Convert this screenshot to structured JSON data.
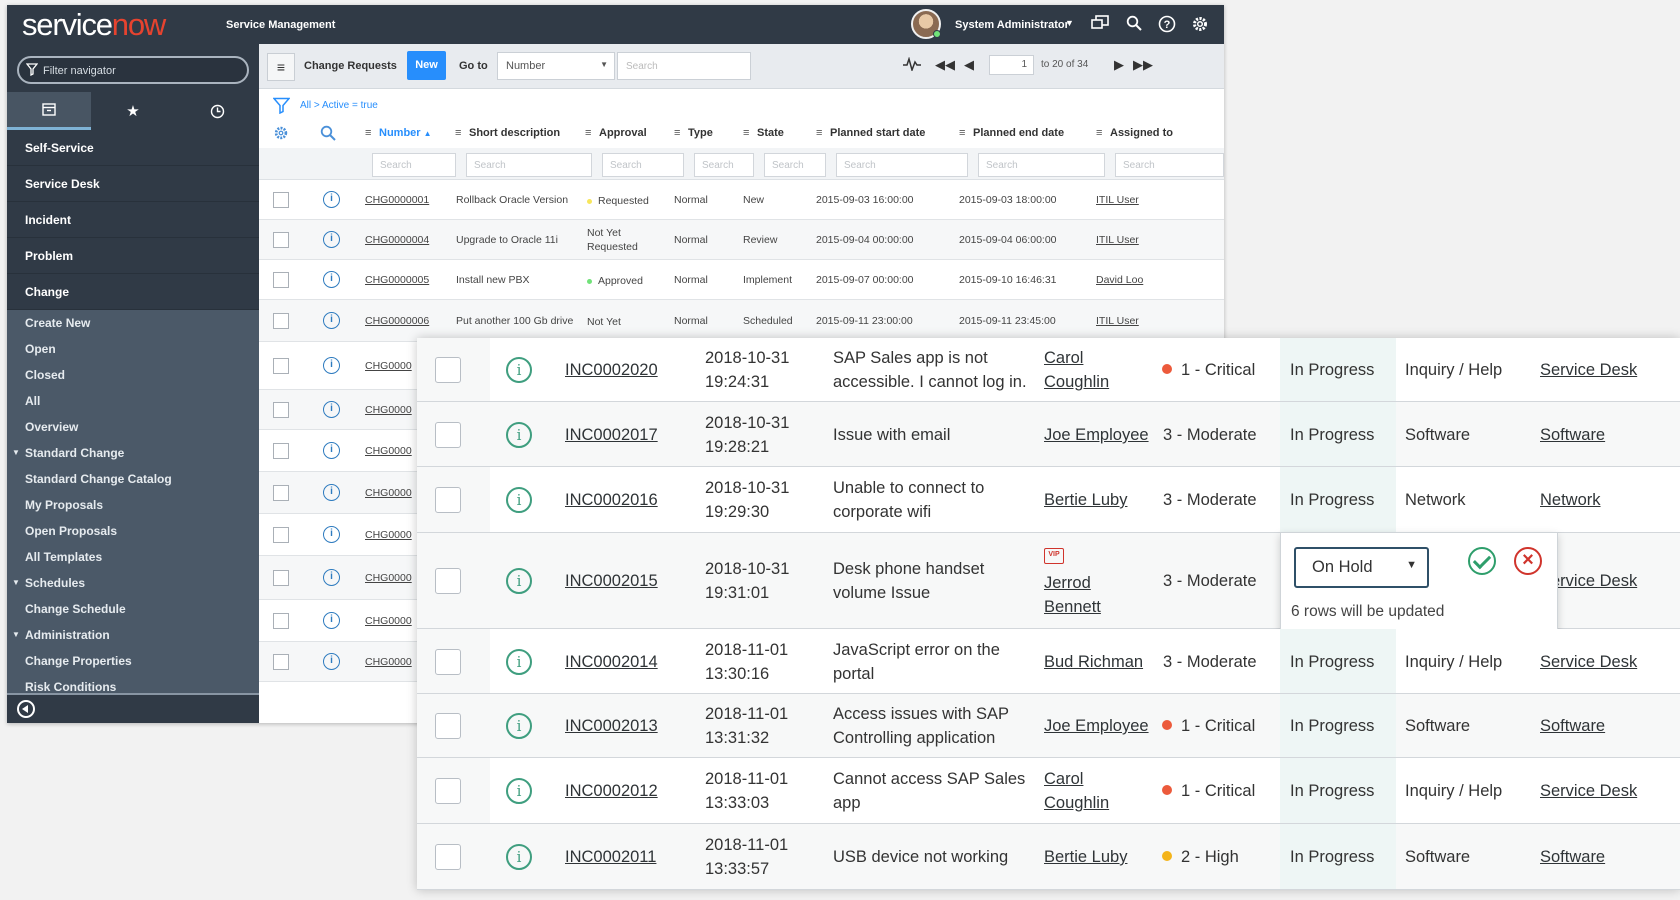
{
  "app": {
    "logo_service": "service",
    "logo_now": "now",
    "product": "Service Management",
    "user_name": "System Administrator"
  },
  "nav": {
    "filter_placeholder": "Filter navigator",
    "modules": [
      "Self-Service",
      "Service Desk",
      "Incident",
      "Problem",
      "Change"
    ],
    "change_items": [
      {
        "label": "Create New",
        "group": false
      },
      {
        "label": "Open",
        "group": false
      },
      {
        "label": "Closed",
        "group": false
      },
      {
        "label": "All",
        "group": false
      },
      {
        "label": "Overview",
        "group": false
      },
      {
        "label": "Standard Change",
        "group": true
      },
      {
        "label": "Standard Change Catalog",
        "group": false
      },
      {
        "label": "My Proposals",
        "group": false
      },
      {
        "label": "Open Proposals",
        "group": false
      },
      {
        "label": "All Templates",
        "group": false
      },
      {
        "label": "Schedules",
        "group": true
      },
      {
        "label": "Change Schedule",
        "group": false
      },
      {
        "label": "Administration",
        "group": true
      },
      {
        "label": "Change Properties",
        "group": false
      },
      {
        "label": "Risk Conditions",
        "group": false
      }
    ]
  },
  "list": {
    "title": "Change Requests",
    "new_label": "New",
    "goto_label": "Go to",
    "goto_field": "Number",
    "search_placeholder": "Search",
    "page_current": "1",
    "page_of": "to 20 of 34",
    "breadcrumb": "All > Active = true",
    "columns": [
      "Number",
      "Short description",
      "Approval",
      "Type",
      "State",
      "Planned start date",
      "Planned end date",
      "Assigned to"
    ],
    "sort_indicator": "▲",
    "rows": [
      {
        "number": "CHG0000001",
        "desc": "Rollback Oracle Version",
        "approval": "Requested",
        "approval_dot": "yellow",
        "type": "Normal",
        "state": "New",
        "start": "2015-09-03 16:00:00",
        "end": "2015-09-03 18:00:00",
        "assigned": "ITIL User"
      },
      {
        "number": "CHG0000004",
        "desc": "Upgrade to Oracle 11i",
        "approval": "Not Yet Requested",
        "approval_dot": "",
        "type": "Normal",
        "state": "Review",
        "start": "2015-09-04 00:00:00",
        "end": "2015-09-04 06:00:00",
        "assigned": "ITIL User"
      },
      {
        "number": "CHG0000005",
        "desc": "Install new PBX",
        "approval": "Approved",
        "approval_dot": "green",
        "type": "Normal",
        "state": "Implement",
        "start": "2015-09-07 00:00:00",
        "end": "2015-09-10 16:46:31",
        "assigned": "David Loo"
      },
      {
        "number": "CHG0000006",
        "desc": "Put another 100 Gb drive",
        "approval": "Not Yet",
        "approval_dot": "",
        "type": "Normal",
        "state": "Scheduled",
        "start": "2015-09-11 23:00:00",
        "end": "2015-09-11 23:45:00",
        "assigned": "ITIL User"
      }
    ],
    "hidden_row_prefix": "CHG0000"
  },
  "incidents": {
    "rows": [
      {
        "number": "INC0002020",
        "date": "2018-10-31",
        "time": "19:24:31",
        "desc1": "SAP Sales app is not",
        "desc2": "accessible. I cannot log in.",
        "caller1": "Carol",
        "caller2": "Coughlin",
        "priority": "1 - Critical",
        "pcolor": "#ec5a3b",
        "state": "In Progress",
        "category": "Inquiry / Help",
        "group": "Service Desk"
      },
      {
        "number": "INC0002017",
        "date": "2018-10-31",
        "time": "19:28:21",
        "desc1": "Issue with email",
        "desc2": "",
        "caller1": "Joe Employee",
        "caller2": "",
        "priority": "3 - Moderate",
        "pcolor": "",
        "state": "In Progress",
        "category": "Software",
        "group": "Software"
      },
      {
        "number": "INC0002016",
        "date": "2018-10-31",
        "time": "19:29:30",
        "desc1": "Unable to connect to",
        "desc2": "corporate wifi",
        "caller1": "Bertie Luby",
        "caller2": "",
        "priority": "3 - Moderate",
        "pcolor": "",
        "state": "In Progress",
        "category": "Network",
        "group": "Network"
      },
      {
        "number": "INC0002015",
        "date": "2018-10-31",
        "time": "19:31:01",
        "desc1": "Desk phone handset",
        "desc2": "volume Issue",
        "caller1": "Jerrod",
        "caller2": "Bennett",
        "priority": "3 - Moderate",
        "pcolor": "",
        "state": "",
        "category": "",
        "group": "Service Desk"
      },
      {
        "number": "INC0002014",
        "date": "2018-11-01",
        "time": "13:30:16",
        "desc1": "JavaScript error on the",
        "desc2": "portal",
        "caller1": "Bud Richman",
        "caller2": "",
        "priority": "3 - Moderate",
        "pcolor": "",
        "state": "In Progress",
        "category": "Inquiry / Help",
        "group": "Service Desk"
      },
      {
        "number": "INC0002013",
        "date": "2018-11-01",
        "time": "13:31:32",
        "desc1": "Access issues with SAP",
        "desc2": "Controlling application",
        "caller1": "Joe Employee",
        "caller2": "",
        "priority": "1 - Critical",
        "pcolor": "#ec5a3b",
        "state": "In Progress",
        "category": "Software",
        "group": "Software"
      },
      {
        "number": "INC0002012",
        "date": "2018-11-01",
        "time": "13:33:03",
        "desc1": "Cannot access SAP Sales",
        "desc2": "app",
        "caller1": "Carol",
        "caller2": "Coughlin",
        "priority": "1 - Critical",
        "pcolor": "#ec5a3b",
        "state": "In Progress",
        "category": "Inquiry / Help",
        "group": "Service Desk"
      },
      {
        "number": "INC0002011",
        "date": "2018-11-01",
        "time": "13:33:57",
        "desc1": "USB device not working",
        "desc2": "",
        "caller1": "Bertie Luby",
        "caller2": "",
        "priority": "2 - High",
        "pcolor": "#f4b41a",
        "state": "In Progress",
        "category": "Software",
        "group": "Software"
      }
    ],
    "editor": {
      "selected": "On Hold",
      "note": "6 rows will be updated",
      "vip_badge": "VIP"
    }
  }
}
